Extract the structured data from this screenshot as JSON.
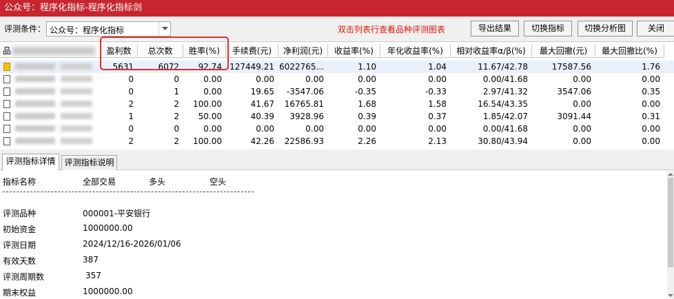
{
  "window": {
    "title": "公众号：程序化指标-程序化指标剑"
  },
  "toolbar": {
    "condition_label": "评测条件：",
    "condition_value": "公众号：程序化指标",
    "hint": "双击列表行查看品种评测图表",
    "export_label": "导出结果",
    "switch_indicator_label": "切换指标",
    "switch_chart_label": "切换分析图",
    "close_label": "关闭"
  },
  "grid": {
    "first_header": "品",
    "columns": [
      "盈利数",
      "总次数",
      "胜率(%)",
      "手续费(元)",
      "净利润(元)",
      "收益率(%)",
      "年化收益率(%)",
      "相对收益率α/β(%)",
      "最大回撤(元)",
      "最大回撤比(%)"
    ],
    "rows": [
      [
        "5631",
        "6072",
        "92.74",
        "127449.21",
        "6022765...",
        "1.10",
        "1.04",
        "11.67/42.78",
        "17587.56",
        "1.76"
      ],
      [
        "0",
        "0",
        "0.00",
        "0.00",
        "0.00",
        "0.00",
        "0.00",
        "0.00/41.68",
        "0.00",
        "0.00"
      ],
      [
        "0",
        "1",
        "0.00",
        "19.65",
        "-3547.06",
        "-0.35",
        "-0.33",
        "2.97/41.32",
        "3547.06",
        "0.35"
      ],
      [
        "2",
        "2",
        "100.00",
        "41.67",
        "16765.81",
        "1.68",
        "1.58",
        "16.54/43.35",
        "0.00",
        "0.00"
      ],
      [
        "1",
        "2",
        "50.00",
        "40.39",
        "3928.96",
        "0.39",
        "0.37",
        "1.85/42.07",
        "3091.44",
        "0.31"
      ],
      [
        "0",
        "0",
        "0.00",
        "0.00",
        "0.00",
        "0.00",
        "0.00",
        "0.00/41.68",
        "0.00",
        "0.00"
      ],
      [
        "2",
        "2",
        "100.00",
        "42.26",
        "22586.93",
        "2.26",
        "2.13",
        "30.80/43.94",
        "0.00",
        "0.00"
      ]
    ]
  },
  "tabs": [
    "评测指标详情",
    "评测指标说明"
  ],
  "detail": {
    "header": [
      "指标名称",
      "全部交易",
      "多头",
      "空头"
    ],
    "separator": "------------------------------------------------------------",
    "items": [
      {
        "label": "评测品种",
        "value": "000001-平安银行"
      },
      {
        "label": "初始资金",
        "value": "1000000.00"
      },
      {
        "label": "评测日期",
        "value": "2024/12/16-2026/01/06"
      },
      {
        "label": "有效天数",
        "value": "387"
      },
      {
        "label": "评测周期数",
        "value": "357"
      },
      {
        "label": "期末权益",
        "value": "1000000.00"
      }
    ]
  },
  "colors": {
    "titlebar": "#c8262e",
    "hint": "#e0140b",
    "highlight": "#e32b2b"
  }
}
